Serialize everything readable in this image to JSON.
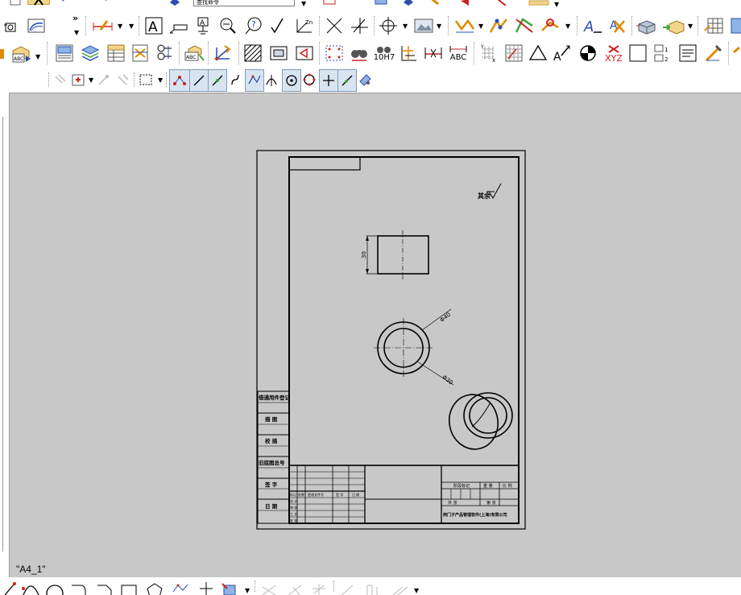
{
  "toolbar": {
    "command_combo_text": "查找命令",
    "dimension_labels": {
      "fit_tolerance": "10H7",
      "text_abc": "ABC",
      "coord_xyz": "XYZ"
    }
  },
  "drawing": {
    "roughness_note": "其余",
    "rect_dim": "30",
    "dia_outer": "Φ40",
    "dia_inner": "Φ30",
    "left_column": [
      "借通用件登记",
      "描 图",
      "校 描",
      "旧底图总号",
      "签 字",
      "日 期"
    ],
    "title_block": {
      "stage_mark": "阶段标记",
      "weight": "重 量",
      "scale": "比 例",
      "sheet_total": "共 张",
      "sheet_no": "第 张",
      "company": "西门子产品管理软件(上海)有限公司",
      "rev_headers": [
        "标记",
        "处数",
        "更改文件号",
        "签 字",
        "日 期"
      ],
      "role_labels": [
        "设 计",
        "审 核",
        "工 艺",
        "批 准"
      ]
    }
  },
  "status": {
    "sheet_name": "\"A4_1\""
  },
  "colors": {
    "canvas_bg": "#c8c8c8",
    "toolbar_bg": "#ffffff",
    "icon_blue": "#2b4fb0",
    "icon_orange": "#e08a00",
    "icon_green": "#3aa63a",
    "icon_red": "#cc2222"
  }
}
